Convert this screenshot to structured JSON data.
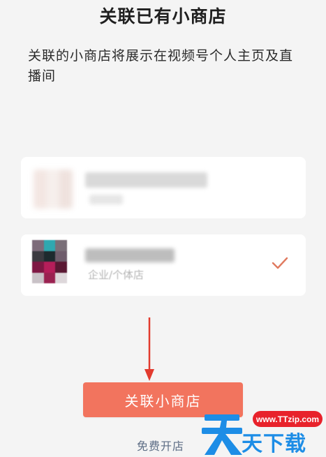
{
  "page": {
    "title": "关联已有小商店",
    "description": "关联的小商店将展示在视频号个人主页及直播间"
  },
  "shops": [
    {
      "name": "",
      "type": "",
      "selected": false
    },
    {
      "name": "",
      "type": "企业/个体店",
      "selected": true
    }
  ],
  "actions": {
    "link_button": "关联小商店",
    "free_open_link": "免费开店"
  },
  "watermark": {
    "url": "www.TTzip.com",
    "text": "天下载"
  },
  "colors": {
    "accent": "#f2745e",
    "check": "#e07a5f",
    "arrow": "#e23a2e",
    "link": "#5d6d85"
  }
}
